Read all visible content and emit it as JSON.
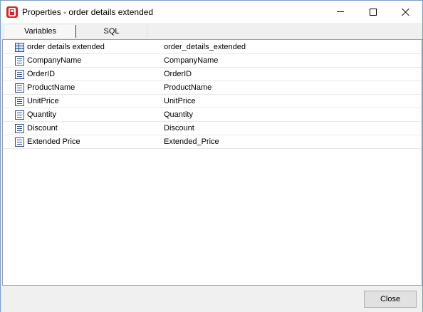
{
  "window": {
    "title": "Properties - order details extended"
  },
  "tabs": [
    {
      "label": "Variables",
      "active": true
    },
    {
      "label": "SQL",
      "active": false
    }
  ],
  "rows": [
    {
      "name": "order details extended",
      "value": "order_details_extended",
      "icon": "table-icon"
    },
    {
      "name": "CompanyName",
      "value": "CompanyName",
      "icon": "field-icon"
    },
    {
      "name": "OrderID",
      "value": "OrderID",
      "icon": "field-icon"
    },
    {
      "name": "ProductName",
      "value": "ProductName",
      "icon": "field-icon"
    },
    {
      "name": "UnitPrice",
      "value": "UnitPrice",
      "icon": "field-icon"
    },
    {
      "name": "Quantity",
      "value": "Quantity",
      "icon": "field-icon"
    },
    {
      "name": "Discount",
      "value": "Discount",
      "icon": "field-icon"
    },
    {
      "name": "Extended Price",
      "value": "Extended_Price",
      "icon": "field-icon"
    }
  ],
  "footer": {
    "close_label": "Close"
  },
  "colors": {
    "app_icon": "#e01f26",
    "icon_blue": "#2a4f9a"
  }
}
